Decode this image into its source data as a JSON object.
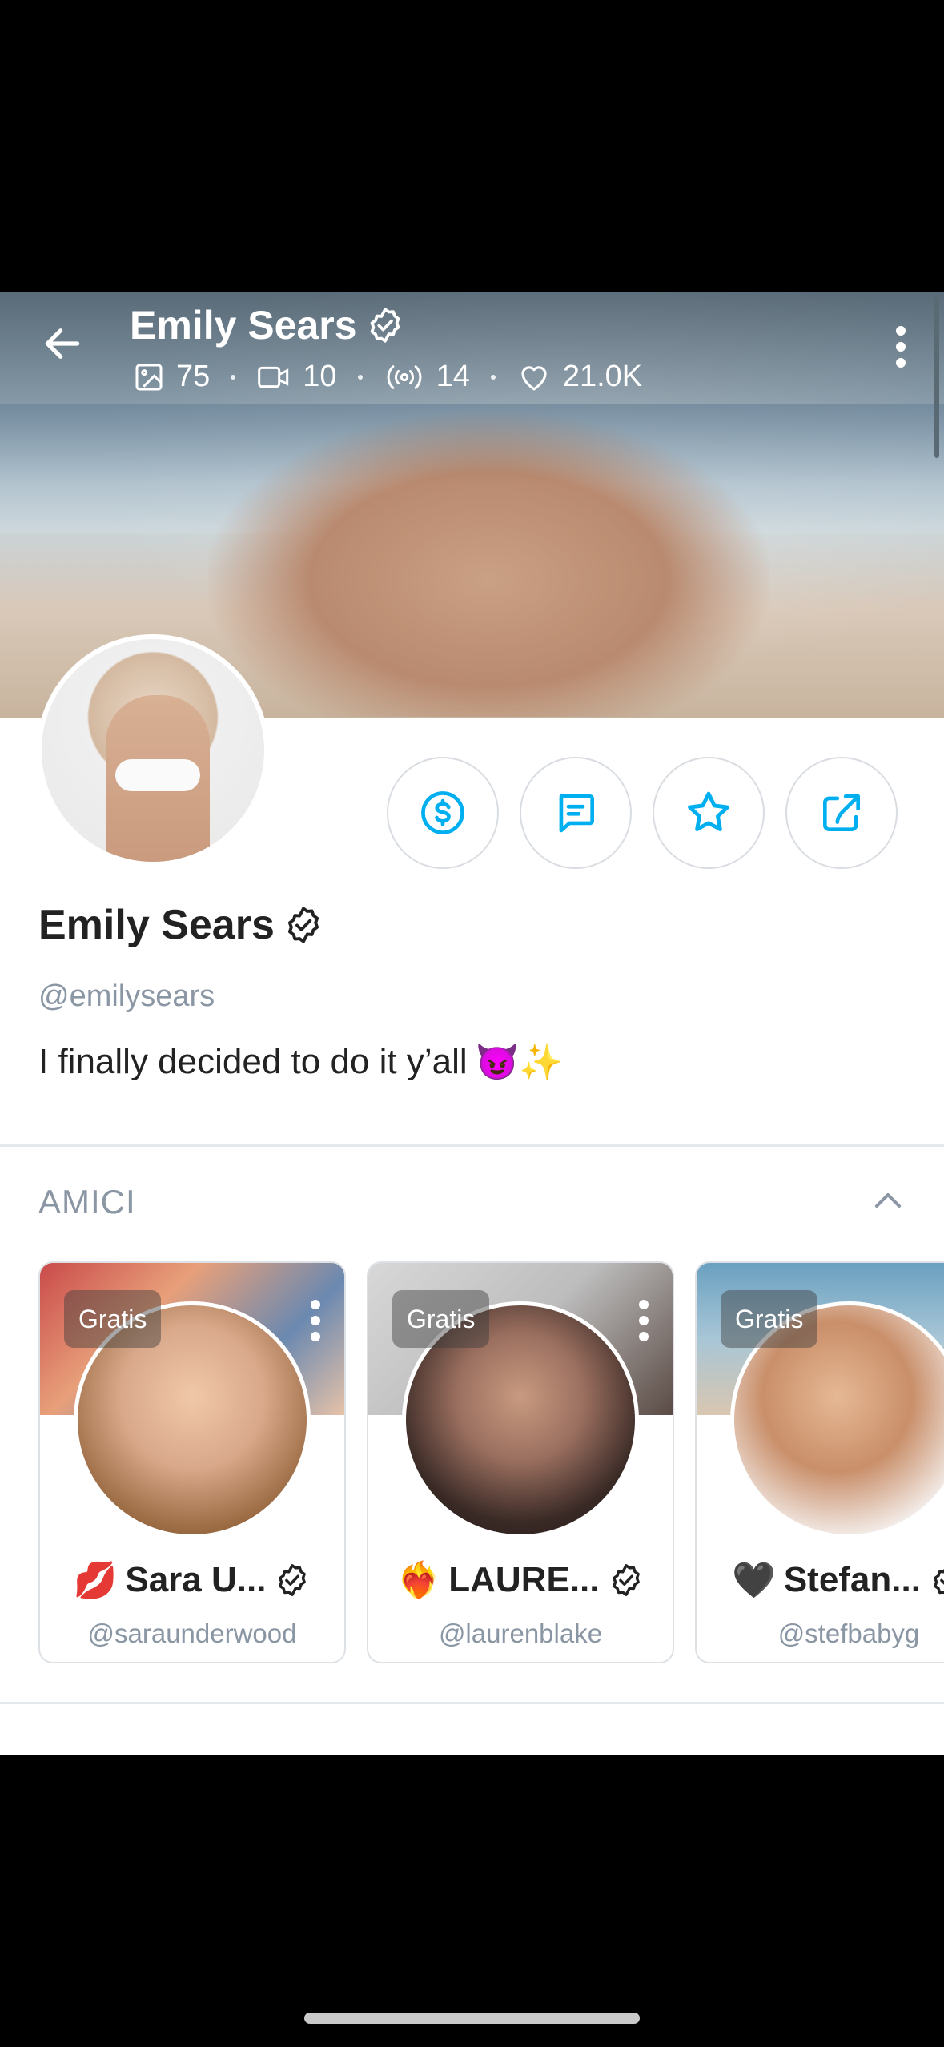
{
  "header": {
    "title": "Emily Sears",
    "stats": [
      {
        "icon": "image-icon",
        "value": "75"
      },
      {
        "icon": "video-icon",
        "value": "10"
      },
      {
        "icon": "broadcast-icon",
        "value": "14"
      },
      {
        "icon": "heart-icon",
        "value": "21.0K"
      }
    ]
  },
  "profile": {
    "name": "Emily Sears",
    "handle": "@emilysears",
    "bio": "I finally decided to do it y’all",
    "bio_emojis": "😈✨"
  },
  "actions": [
    {
      "name": "tip-button",
      "icon": "dollar-icon"
    },
    {
      "name": "message-button",
      "icon": "chat-icon"
    },
    {
      "name": "favorite-button",
      "icon": "star-icon"
    },
    {
      "name": "share-button",
      "icon": "share-icon"
    }
  ],
  "friends": {
    "title": "AMICI",
    "cards": [
      {
        "badge": "Gratis",
        "emoji": "💋",
        "name": "Sara U...",
        "handle": "@saraunderwood"
      },
      {
        "badge": "Gratis",
        "emoji": "❤️‍🔥",
        "name": "LAURE...",
        "handle": "@laurenblake"
      },
      {
        "badge": "Gratis",
        "emoji": "🖤",
        "name": "Stefan...",
        "handle": "@stefbabyg"
      }
    ]
  },
  "colors": {
    "accent": "#00aff0",
    "muted": "#8a96a3",
    "text": "#222222"
  }
}
